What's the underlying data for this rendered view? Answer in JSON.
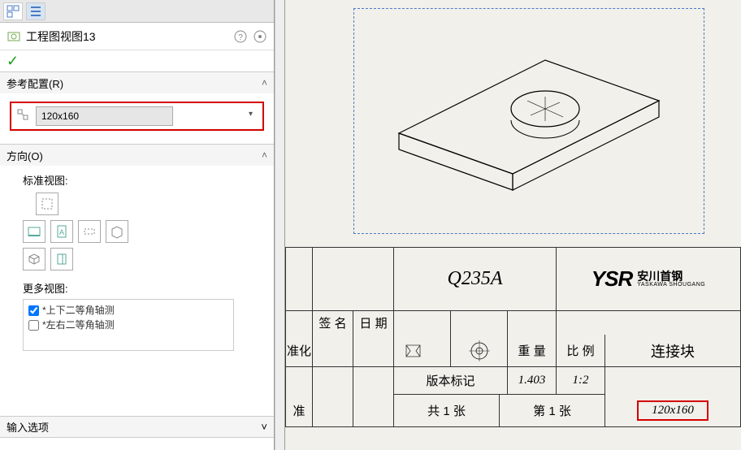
{
  "header": {
    "title": "工程图视图13"
  },
  "sections": {
    "reference_config": {
      "label": "参考配置(R)",
      "selected": "120x160"
    },
    "orientation": {
      "label": "方向(O)",
      "standard_views_label": "标准视图:",
      "more_views_label": "更多视图:",
      "more_views": [
        {
          "checked": true,
          "label": "*上下二等角轴测"
        },
        {
          "checked": false,
          "label": "*左右二等角轴测"
        }
      ]
    },
    "input_options": {
      "label": "输入选项"
    }
  },
  "title_block": {
    "material": "Q235A",
    "logo_main": "YSR",
    "logo_cn": "安川首钢",
    "logo_en": "YASKAWA SHOUGANG",
    "sign_label": "签 名",
    "date_label": "日 期",
    "std_label": "准化",
    "weight_label": "重 量",
    "scale_label": "比 例",
    "partname": "连接块",
    "rev_label": "版本标记",
    "rev_weight": "1.403",
    "rev_scale": "1:2",
    "approve_label": "准",
    "sheet_total": "共 1 张",
    "sheet_current": "第 1 张",
    "config_value": "120x160"
  }
}
